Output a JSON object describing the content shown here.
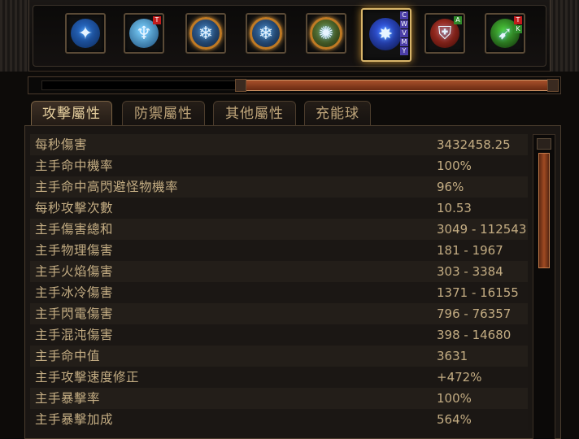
{
  "skills": [
    {
      "icon": "blue-sphere-skill-icon",
      "glyph": "✦",
      "colors": [
        "#2a6fd0",
        "#0c2a5a"
      ],
      "badges": []
    },
    {
      "icon": "frost-figures-skill-icon",
      "glyph": "♆",
      "colors": [
        "#7fd4ff",
        "#1a4c7a"
      ],
      "badges": [
        {
          "text": "T",
          "color": "red"
        }
      ]
    },
    {
      "icon": "ice-ring-skill-icon",
      "glyph": "❄",
      "colors": [
        "#3a6ea8",
        "#0d1f38"
      ],
      "badges": []
    },
    {
      "icon": "ice-ring-skill-icon",
      "glyph": "❄",
      "colors": [
        "#3a6ea8",
        "#0d1f38"
      ],
      "badges": []
    },
    {
      "icon": "arcane-sigil-skill-icon",
      "glyph": "✺",
      "colors": [
        "#6a8a3a",
        "#1e2a10"
      ],
      "badges": []
    },
    {
      "icon": "lightning-orb-skill-icon",
      "glyph": "✸",
      "colors": [
        "#3a62ff",
        "#0a1240"
      ],
      "badges": [
        {
          "text": "C",
          "color": "purple"
        },
        {
          "text": "W",
          "color": "purple"
        },
        {
          "text": "V",
          "color": "purple"
        },
        {
          "text": "M",
          "color": "purple"
        },
        {
          "text": "Y",
          "color": "purple"
        }
      ],
      "selected": true
    },
    {
      "icon": "shield-bearer-skill-icon",
      "glyph": "⛨",
      "colors": [
        "#c8382a",
        "#3a0a06"
      ],
      "badges": [
        {
          "text": "A",
          "color": "green"
        }
      ]
    },
    {
      "icon": "green-spear-skill-icon",
      "glyph": "➹",
      "colors": [
        "#4ccc3a",
        "#0e2a08"
      ],
      "badges": [
        {
          "text": "T",
          "color": "red"
        },
        {
          "text": "K",
          "color": "green"
        }
      ]
    }
  ],
  "xp_progress": 0.57,
  "tabs": [
    "攻擊屬性",
    "防禦屬性",
    "其他屬性",
    "充能球"
  ],
  "active_tab": 0,
  "stats": [
    {
      "label": "每秒傷害",
      "value": "3432458.25"
    },
    {
      "label": "主手命中機率",
      "value": "100%"
    },
    {
      "label": "主手命中高閃避怪物機率",
      "value": "96%"
    },
    {
      "label": "每秒攻擊次數",
      "value": "10.53"
    },
    {
      "label": "主手傷害總和",
      "value": "3049 - 112543"
    },
    {
      "label": "主手物理傷害",
      "value": "181 - 1967"
    },
    {
      "label": "主手火焰傷害",
      "value": "303 - 3384"
    },
    {
      "label": "主手冰冷傷害",
      "value": "1371 - 16155"
    },
    {
      "label": "主手閃電傷害",
      "value": "796 - 76357"
    },
    {
      "label": "主手混沌傷害",
      "value": "398 - 14680"
    },
    {
      "label": "主手命中值",
      "value": "3631"
    },
    {
      "label": "主手攻擊速度修正",
      "value": "+472%"
    },
    {
      "label": "主手暴擊率",
      "value": "100%"
    },
    {
      "label": "主手暴擊加成",
      "value": "564%"
    }
  ],
  "scroll_position": 0.0
}
